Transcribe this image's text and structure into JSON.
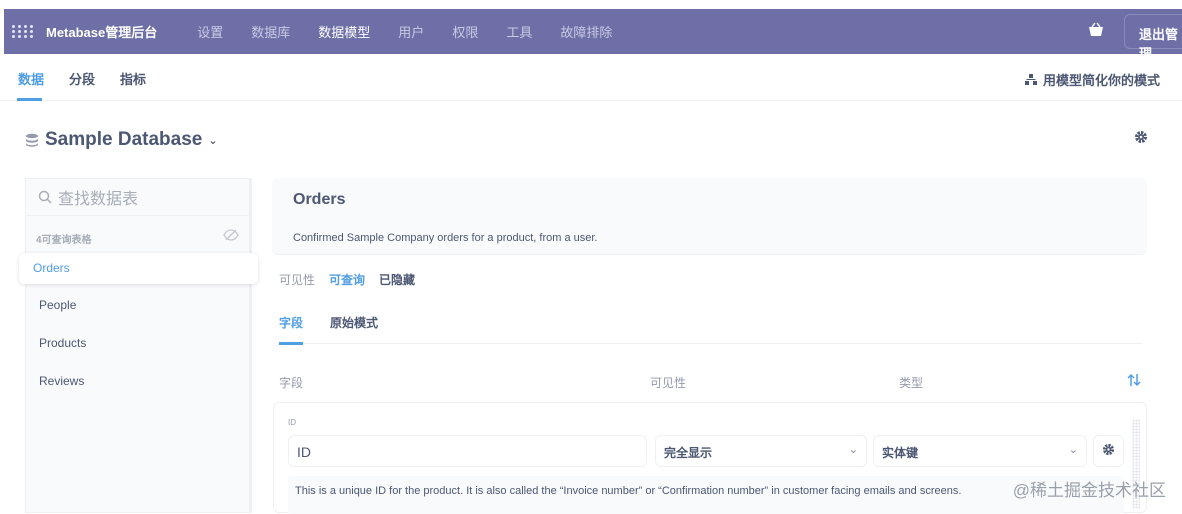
{
  "topbar": {
    "brand": "Metabase管理后台",
    "nav": [
      "设置",
      "数据库",
      "数据模型",
      "用户",
      "权限",
      "工具",
      "故障排除"
    ],
    "active_nav": "数据模型",
    "exit": "退出管理",
    "color": "#6e6fa7"
  },
  "subnav": {
    "tabs": [
      "数据",
      "分段",
      "指标"
    ],
    "active": "数据",
    "simplify": "用模型简化你的模式"
  },
  "database": {
    "name": "Sample Database"
  },
  "sidebar": {
    "search_placeholder": "查找数据表",
    "count_label": "4可查询表格",
    "tables": [
      "Orders",
      "People",
      "Products",
      "Reviews"
    ],
    "selected": "Orders"
  },
  "table": {
    "name": "Orders",
    "description": "Confirmed Sample Company orders for a product, from a user.",
    "visibility": {
      "label": "可见性",
      "options": [
        "可查询",
        "已隐藏"
      ],
      "selected": "可查询"
    },
    "tabs": [
      "字段",
      "原始模式"
    ],
    "active_tab": "字段",
    "columns": [
      "字段",
      "可见性",
      "类型"
    ],
    "fields": [
      {
        "label": "ID",
        "name": "ID",
        "visibility": "完全显示",
        "type": "实体键",
        "description": "This is a unique ID for the product. It is also called the “Invoice number” or “Confirmation number” in customer facing emails and screens."
      }
    ]
  },
  "watermark": "@稀土掘金技术社区",
  "colors": {
    "accent": "#509ee3",
    "text": "#4c5773"
  }
}
